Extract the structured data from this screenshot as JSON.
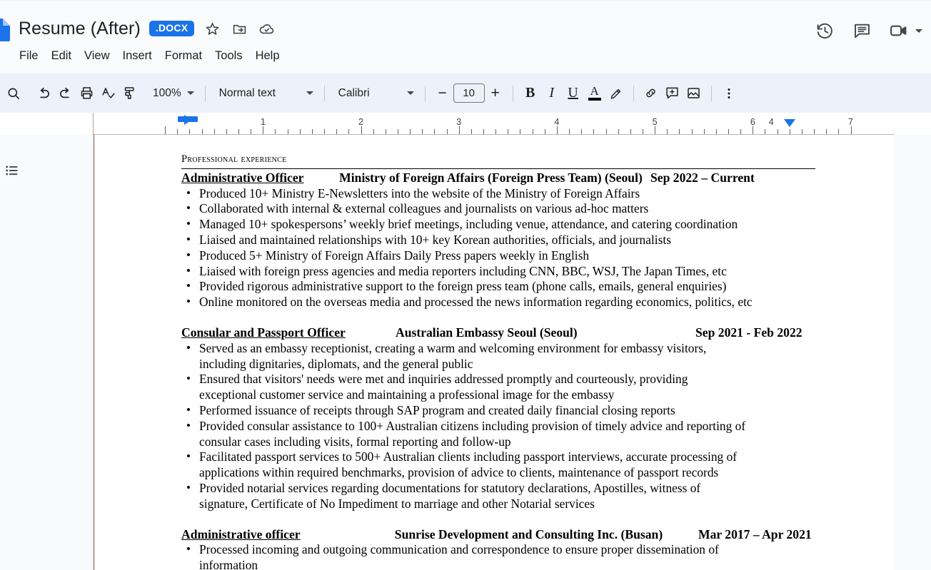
{
  "app": {
    "doc_icon": "google-docs-icon",
    "title": "Resume (After)",
    "format_badge": ".DOCX"
  },
  "header": {
    "icons": [
      {
        "name": "star-icon",
        "label": "Star"
      },
      {
        "name": "move-to-folder-icon",
        "label": "Move"
      },
      {
        "name": "cloud-saved-icon",
        "label": "Saved to Drive"
      }
    ],
    "menu": [
      "File",
      "Edit",
      "View",
      "Insert",
      "Format",
      "Tools",
      "Help"
    ],
    "right_icons": [
      {
        "name": "version-history-icon",
        "label": "Version history"
      },
      {
        "name": "comment-history-icon",
        "label": "Open comment history"
      },
      {
        "name": "video-meet-icon",
        "label": "Join a call"
      }
    ]
  },
  "toolbar": {
    "search_icon": "search-icon",
    "undo_icon": "undo-icon",
    "redo_icon": "redo-icon",
    "print_icon": "print-icon",
    "spellcheck_icon": "spellcheck-icon",
    "paint_format_icon": "paint-format-icon",
    "zoom_value": "100%",
    "style_value": "Normal text",
    "font_value": "Calibri",
    "font_decrease": "−",
    "font_size_value": "10",
    "font_increase": "+",
    "bold": "B",
    "italic": "I",
    "underline": "U",
    "text_color": "A",
    "highlight_icon": "highlight-pen-icon",
    "link_icon": "insert-link-icon",
    "comment_icon": "add-comment-icon",
    "image_icon": "insert-image-icon",
    "more_icon": "more-options-icon"
  },
  "ruler": {
    "numbers": [
      "1",
      "2",
      "3",
      "4",
      "5",
      "6",
      "7"
    ],
    "first_line_indent_marker": "first-line-indent-marker",
    "left_indent_marker": "left-indent-marker",
    "right_indent_marker": "right-indent-marker"
  },
  "sidebar": {
    "outline_icon": "document-outline-icon"
  },
  "document": {
    "section_heading": "Professional experience",
    "jobs": [
      {
        "title": "Administrative Officer",
        "org": "Ministry of Foreign Affairs (Foreign Press Team) (Seoul)",
        "date": "Sep 2022 – Current",
        "bullets": [
          "Produced 10+ Ministry E-Newsletters into the website of the Ministry of Foreign Affairs",
          "Collaborated with internal & external colleagues and journalists on various ad-hoc matters",
          "Managed 10+ spokespersons’ weekly brief meetings, including venue, attendance, and catering coordination",
          "Liaised and maintained relationships with 10+ key Korean authorities, officials, and journalists",
          "Produced 5+ Ministry of Foreign Affairs Daily Press papers weekly in English",
          "Liaised with foreign press agencies and media reporters including CNN, BBC, WSJ, The Japan Times, etc",
          "Provided rigorous administrative support to the foreign press team (phone calls, emails, general enquiries)",
          "Online monitored on the overseas media and processed the news information regarding economics, politics, etc"
        ]
      },
      {
        "title": "Consular and Passport Officer",
        "org": "Australian Embassy Seoul (Seoul)",
        "date": "Sep 2021 - Feb 2022",
        "bullets": [
          "Served as an embassy receptionist, creating a warm and welcoming environment for embassy visitors, including dignitaries, diplomats, and the general public",
          "Ensured that visitors' needs were met and inquiries addressed promptly and courteously, providing exceptional customer service and maintaining a professional image for the embassy",
          "Performed issuance of receipts through SAP program and created daily financial closing reports",
          "Provided consular assistance to 100+ Australian citizens including provision of timely advice and reporting of consular cases including visits, formal reporting and follow-up",
          "Facilitated passport services to 500+ Australian clients including passport interviews, accurate processing of applications within required benchmarks, provision of advice to clients, maintenance of passport records",
          "Provided notarial services regarding documentations for statutory declarations, Apostilles, witness of signature, Certificate of No Impediment to marriage and other Notarial services"
        ]
      },
      {
        "title": "Administrative officer",
        "org": "Sunrise Development and Consulting Inc. (Busan)",
        "date": "Mar 2017 – Apr 2021",
        "bullets": [
          "Processed incoming and outgoing communication and correspondence to ensure proper dissemination of information"
        ]
      }
    ]
  },
  "colors": {
    "accent": "#1a73e8",
    "toolbar_bg": "#edf2fa",
    "header_bg": "#f9fbfd",
    "canvas_bg": "#f8fafd",
    "margin_line": "#7a4b45"
  }
}
